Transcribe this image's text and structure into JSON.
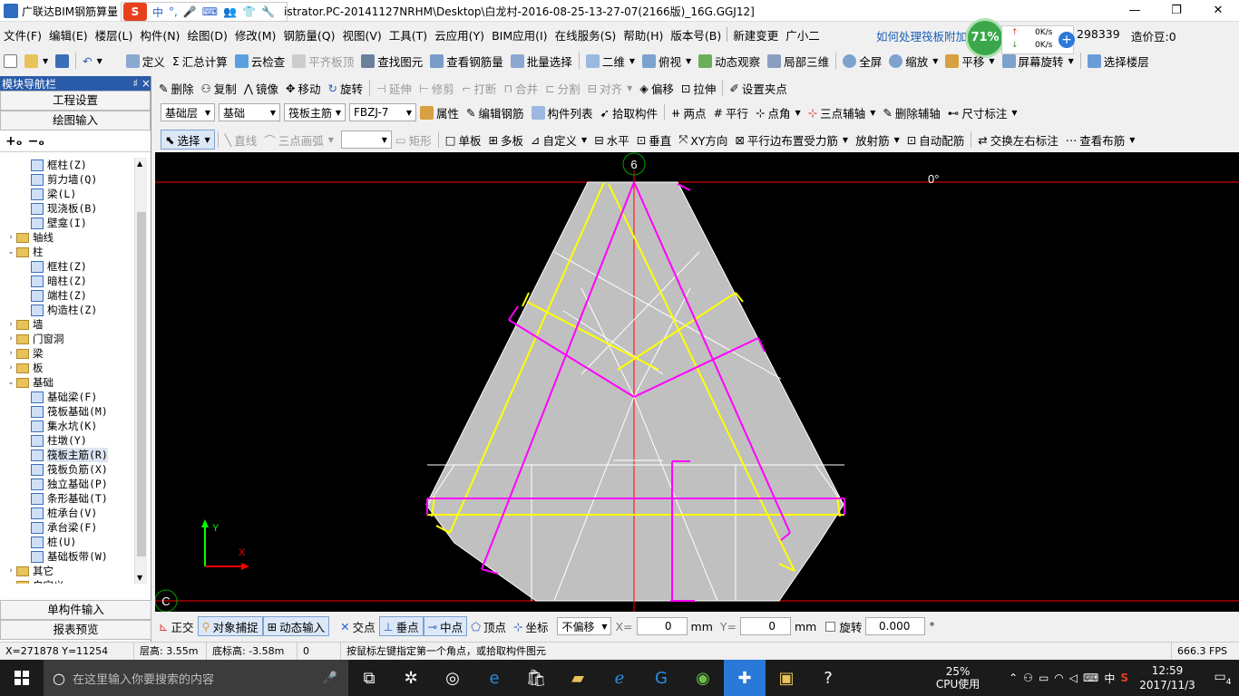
{
  "titlebar": {
    "title_left": "广联达BIM钢筋算量",
    "title_right": "istrator.PC-20141127NRHM\\Desktop\\白龙村-2016-08-25-13-27-07(2166版)_16G.GGJ12]",
    "ime_logo": "S",
    "ime_mode": "中"
  },
  "menu": {
    "items": [
      "文件(F)",
      "编辑(E)",
      "楼层(L)",
      "构件(N)",
      "绘图(D)",
      "修改(M)",
      "钢筋量(Q)",
      "视图(V)",
      "工具(T)",
      "云应用(Y)",
      "BIM应用(I)",
      "在线服务(S)",
      "帮助(H)",
      "版本号(B)",
      "新建变更",
      "广小二"
    ],
    "question": "如何处理筏板附加",
    "account": "298339",
    "price": "造价豆:0"
  },
  "network": {
    "percent": "71%",
    "up": "0K/s",
    "down": "0K/s"
  },
  "toolbar1": [
    "定义",
    "汇总计算",
    "云检查",
    "平齐板顶",
    "查找图元",
    "查看钢筋量",
    "批量选择",
    "二维",
    "俯视",
    "动态观察",
    "局部三维",
    "全屏",
    "缩放",
    "平移",
    "屏幕旋转",
    "选择楼层"
  ],
  "toolbar2": [
    "删除",
    "复制",
    "镜像",
    "移动",
    "旋转",
    "延伸",
    "修剪",
    "打断",
    "合并",
    "分割",
    "对齐",
    "偏移",
    "拉伸",
    "设置夹点"
  ],
  "toolbar3": {
    "floor": "基础层",
    "category": "基础",
    "type": "筏板主筋",
    "component": "FBZJ-7",
    "buttons": [
      "属性",
      "编辑钢筋",
      "构件列表",
      "拾取构件",
      "两点",
      "平行",
      "点角",
      "三点辅轴",
      "删除辅轴",
      "尺寸标注"
    ]
  },
  "toolbar4": [
    "选择",
    "直线",
    "三点画弧",
    "矩形",
    "单板",
    "多板",
    "自定义",
    "水平",
    "垂直",
    "XY方向",
    "平行边布置受力筋",
    "放射筋",
    "自动配筋",
    "交换左右标注",
    "查看布筋"
  ],
  "sidebar": {
    "header": "模块导航栏",
    "pin": "♯ ×",
    "btn_settings": "工程设置",
    "btn_draw": "绘图输入",
    "tree": [
      {
        "level": 2,
        "type": "leaf",
        "label": "框柱(Z)"
      },
      {
        "level": 2,
        "type": "leaf",
        "label": "剪力墙(Q)"
      },
      {
        "level": 2,
        "type": "leaf",
        "label": "梁(L)"
      },
      {
        "level": 2,
        "type": "leaf",
        "label": "现浇板(B)"
      },
      {
        "level": 2,
        "type": "leaf",
        "label": "壁龛(I)"
      },
      {
        "level": 1,
        "type": "folder",
        "exp": ">",
        "label": "轴线"
      },
      {
        "level": 1,
        "type": "folder",
        "exp": "v",
        "label": "柱"
      },
      {
        "level": 2,
        "type": "leaf",
        "label": "框柱(Z)"
      },
      {
        "level": 2,
        "type": "leaf",
        "label": "暗柱(Z)"
      },
      {
        "level": 2,
        "type": "leaf",
        "label": "端柱(Z)"
      },
      {
        "level": 2,
        "type": "leaf",
        "label": "构造柱(Z)"
      },
      {
        "level": 1,
        "type": "folder",
        "exp": ">",
        "label": "墙"
      },
      {
        "level": 1,
        "type": "folder",
        "exp": ">",
        "label": "门窗洞"
      },
      {
        "level": 1,
        "type": "folder",
        "exp": ">",
        "label": "梁"
      },
      {
        "level": 1,
        "type": "folder",
        "exp": ">",
        "label": "板"
      },
      {
        "level": 1,
        "type": "folder",
        "exp": "v",
        "label": "基础"
      },
      {
        "level": 2,
        "type": "leaf",
        "label": "基础梁(F)"
      },
      {
        "level": 2,
        "type": "leaf",
        "label": "筏板基础(M)"
      },
      {
        "level": 2,
        "type": "leaf",
        "label": "集水坑(K)"
      },
      {
        "level": 2,
        "type": "leaf",
        "label": "柱墩(Y)"
      },
      {
        "level": 2,
        "type": "leaf",
        "label": "筏板主筋(R)",
        "selected": true
      },
      {
        "level": 2,
        "type": "leaf",
        "label": "筏板负筋(X)"
      },
      {
        "level": 2,
        "type": "leaf",
        "label": "独立基础(P)"
      },
      {
        "level": 2,
        "type": "leaf",
        "label": "条形基础(T)"
      },
      {
        "level": 2,
        "type": "leaf",
        "label": "桩承台(V)"
      },
      {
        "level": 2,
        "type": "leaf",
        "label": "承台梁(F)"
      },
      {
        "level": 2,
        "type": "leaf",
        "label": "桩(U)"
      },
      {
        "level": 2,
        "type": "leaf",
        "label": "基础板带(W)"
      },
      {
        "level": 1,
        "type": "folder",
        "exp": ">",
        "label": "其它"
      },
      {
        "level": 1,
        "type": "folder",
        "exp": ">",
        "label": "自定义"
      }
    ],
    "btn_single": "单构件输入",
    "btn_report": "报表预览"
  },
  "canvas": {
    "axis_label_top": "6",
    "axis_label_left": "C",
    "angle": "0°",
    "ucs_x": "X",
    "ucs_y": "Y",
    "colors": {
      "bg": "#000000",
      "slab": "#c0c0c0",
      "yellow": "#ffff00",
      "magenta": "#ff00ff",
      "red": "#ff0000",
      "white": "#ffffff"
    }
  },
  "snapbar": {
    "buttons": [
      "正交",
      "对象捕捉",
      "动态输入",
      "交点",
      "垂点",
      "中点",
      "顶点",
      "坐标"
    ],
    "offset_mode": "不偏移",
    "x_label": "X=",
    "x_value": "0",
    "y_label": "Y=",
    "y_value": "0",
    "unit": "mm",
    "rotate_label": "旋转",
    "rotate_value": "0.000",
    "degree": "°"
  },
  "status": {
    "coords": "X=271878 Y=11254",
    "floor_height": "层高: 3.55m",
    "bottom_height": "底标高: -3.58m",
    "zero": "0",
    "hint": "按鼠标左键指定第一个角点，或拾取构件图元",
    "fps": "666.3 FPS"
  },
  "taskbar": {
    "search_placeholder": "在这里输入你要搜索的内容",
    "cpu_percent": "25%",
    "cpu_label": "CPU使用",
    "ime": "中",
    "time": "12:59",
    "date": "2017/11/3",
    "notify": "4"
  }
}
